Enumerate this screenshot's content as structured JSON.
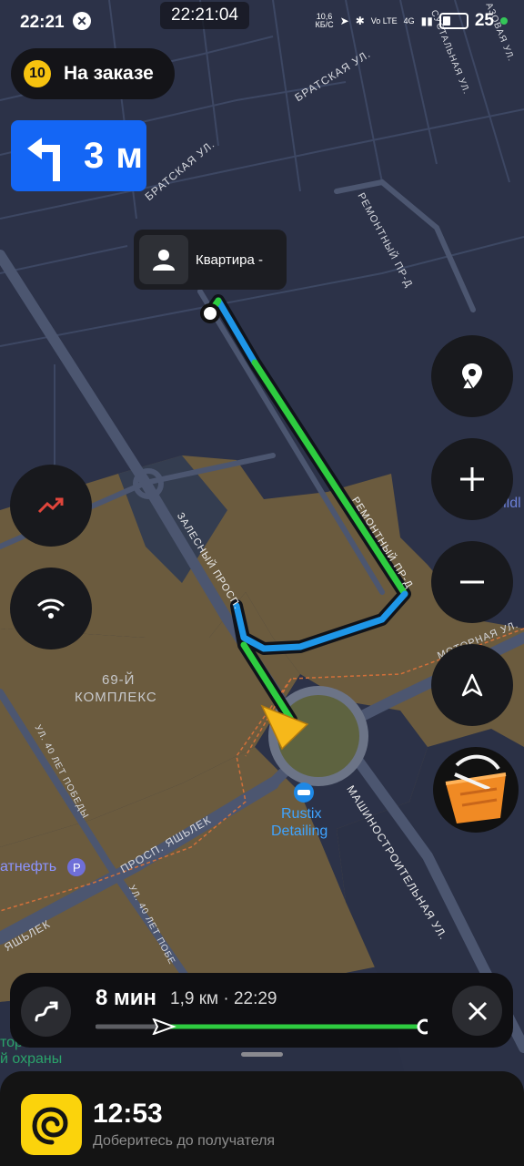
{
  "status_bar": {
    "time": "22:21",
    "clock_pill": "22:21:04",
    "net_speed_top": "10,6",
    "net_speed_bottom": "КБ/С",
    "volte": "Vo LTE",
    "network": "4G",
    "battery": "25"
  },
  "order": {
    "badge": "10",
    "label": "На заказе"
  },
  "maneuver": {
    "distance": "3 м"
  },
  "destination": {
    "label": "Квартира -"
  },
  "map_labels": {
    "bratskaya": "БРАТСКАЯ УЛ.",
    "bratskaya2": "БРАТСКАЯ УЛ.",
    "remontny_top": "РЕМОНТНЫЙ ПР-Д",
    "remontny_mid": "РЕМОНТНЫЙ ПР-Д",
    "zalesny": "ЗАЛЕСНЫЙ ПРОСП.",
    "motornaya": "МОТОРНАЯ УЛ.",
    "complex_line1": "69-Й",
    "complex_line2": "КОМПЛЕКС",
    "pobedy": "УЛ. 40 ЛЕТ ПОБЕДЫ",
    "pobedy2": "УЛ. 40 ЛЕТ ПОБЕ",
    "yashlek": "ПРОСП. ЯШЬЛЕК",
    "yashlek2": "ЯШЬЛЕК",
    "mashino": "МАШИНОСТРОИТЕЛЬНАЯ УЛ.",
    "rustix_line1": "Rustix",
    "rustix_line2": "Detailing",
    "tatneft": "атнефть",
    "okhrany_line1": "тор",
    "okhrany_line2": "й охраны",
    "wildb": "Wildl",
    "pustal": "СУСТАЛЬНАЯ УЛ.",
    "gazovaya": "АЗОВАЯ УЛ."
  },
  "eta": {
    "minutes": "8 мин",
    "details": "1,9 км · 22:29",
    "route_progress": 0.2
  },
  "bottom": {
    "time": "12:53",
    "subtitle": "Доберитесь до получателя"
  },
  "colors": {
    "route_green": "#2ecc40",
    "route_blue": "#1e96e8",
    "maneuver_blue": "#1466f5",
    "brand_yellow": "#fbd30c",
    "cursor_yellow": "#f6b81a"
  }
}
